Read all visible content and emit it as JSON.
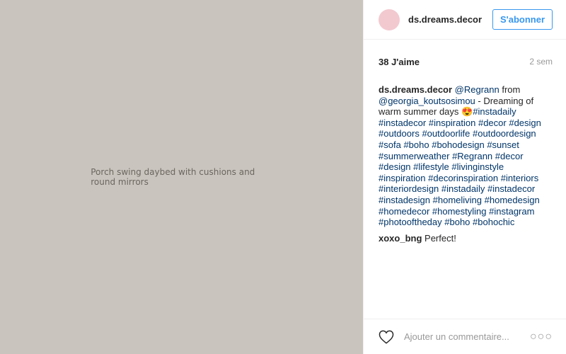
{
  "post": {
    "image_alt": "Porch swing daybed with cushions and round mirrors"
  },
  "header": {
    "username": "ds.dreams.decor",
    "follow_label": "S'abonner"
  },
  "stats": {
    "likes": "38 J'aime",
    "time": "2 sem"
  },
  "caption": {
    "user": "ds.dreams.decor",
    "segments": [
      {
        "text": "@Regrann",
        "link": true
      },
      {
        "text": " from ",
        "link": false
      },
      {
        "text": "@georgia_koutsosimou",
        "link": true
      },
      {
        "text": " - Dreaming of warm summer days 😍",
        "link": false
      },
      {
        "text": "#instadaily",
        "link": true
      },
      {
        "text": " ",
        "link": false
      },
      {
        "text": "#instadecor",
        "link": true
      },
      {
        "text": " ",
        "link": false
      },
      {
        "text": "#inspiration",
        "link": true
      },
      {
        "text": " ",
        "link": false
      },
      {
        "text": "#decor",
        "link": true
      },
      {
        "text": " ",
        "link": false
      },
      {
        "text": "#design",
        "link": true
      },
      {
        "text": " ",
        "link": false
      },
      {
        "text": "#outdoors",
        "link": true
      },
      {
        "text": " ",
        "link": false
      },
      {
        "text": "#outdoorlife",
        "link": true
      },
      {
        "text": " ",
        "link": false
      },
      {
        "text": "#outdoordesign",
        "link": true
      },
      {
        "text": " ",
        "link": false
      },
      {
        "text": "#sofa",
        "link": true
      },
      {
        "text": " ",
        "link": false
      },
      {
        "text": "#boho",
        "link": true
      },
      {
        "text": " ",
        "link": false
      },
      {
        "text": "#bohodesign",
        "link": true
      },
      {
        "text": " ",
        "link": false
      },
      {
        "text": "#sunset",
        "link": true
      },
      {
        "text": " ",
        "link": false
      },
      {
        "text": "#summerweather",
        "link": true
      },
      {
        "text": " ",
        "link": false
      },
      {
        "text": "#Regrann",
        "link": true
      },
      {
        "text": " ",
        "link": false
      },
      {
        "text": "#decor",
        "link": true
      },
      {
        "text": " ",
        "link": false
      },
      {
        "text": "#design",
        "link": true
      },
      {
        "text": " ",
        "link": false
      },
      {
        "text": "#lifestyle",
        "link": true
      },
      {
        "text": " ",
        "link": false
      },
      {
        "text": "#livinginstyle",
        "link": true
      },
      {
        "text": " ",
        "link": false
      },
      {
        "text": "#inspiration",
        "link": true
      },
      {
        "text": " ",
        "link": false
      },
      {
        "text": "#decorinspiration",
        "link": true
      },
      {
        "text": " ",
        "link": false
      },
      {
        "text": "#interiors",
        "link": true
      },
      {
        "text": " ",
        "link": false
      },
      {
        "text": "#interiordesign",
        "link": true
      },
      {
        "text": " ",
        "link": false
      },
      {
        "text": "#instadaily",
        "link": true
      },
      {
        "text": " ",
        "link": false
      },
      {
        "text": "#instadecor",
        "link": true
      },
      {
        "text": " ",
        "link": false
      },
      {
        "text": "#instadesign",
        "link": true
      },
      {
        "text": " ",
        "link": false
      },
      {
        "text": "#homeliving",
        "link": true
      },
      {
        "text": " ",
        "link": false
      },
      {
        "text": "#homedesign",
        "link": true
      },
      {
        "text": " ",
        "link": false
      },
      {
        "text": "#homedecor",
        "link": true
      },
      {
        "text": " ",
        "link": false
      },
      {
        "text": "#homestyling",
        "link": true
      },
      {
        "text": " ",
        "link": false
      },
      {
        "text": "#instagram",
        "link": true
      },
      {
        "text": " ",
        "link": false
      },
      {
        "text": "#photooftheday",
        "link": true
      },
      {
        "text": " ",
        "link": false
      },
      {
        "text": "#boho",
        "link": true
      },
      {
        "text": " ",
        "link": false
      },
      {
        "text": "#bohochic",
        "link": true
      }
    ]
  },
  "comments": [
    {
      "user": "xoxo_bng",
      "text": "Perfect!"
    }
  ],
  "footer": {
    "like_icon": "heart-outline-icon",
    "comment_placeholder": "Ajouter un commentaire...",
    "more_label": "○○○"
  },
  "colors": {
    "accent": "#3897f0",
    "link": "#003569",
    "muted": "#999999",
    "text": "#262626"
  }
}
